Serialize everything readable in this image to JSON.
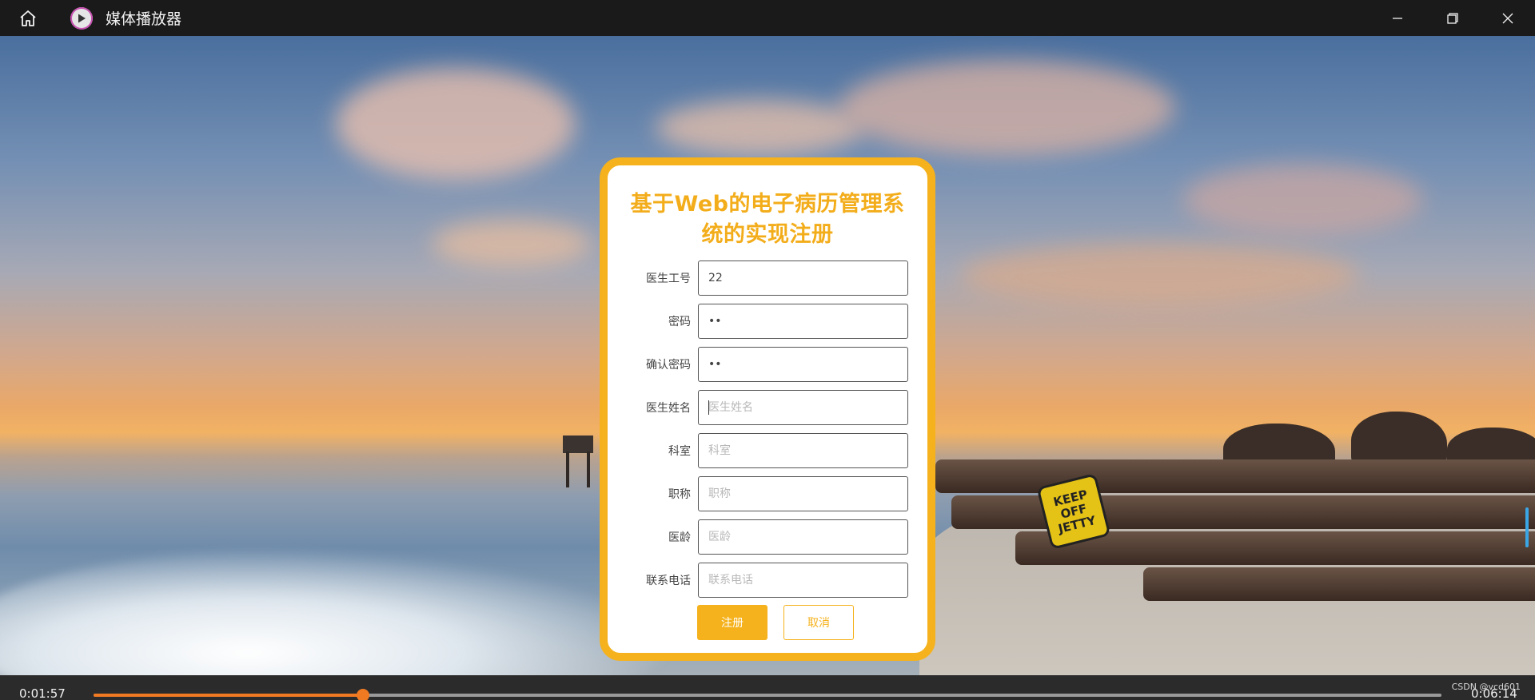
{
  "window": {
    "title": "媒体播放器",
    "icons": {
      "home": "home-icon",
      "app": "play-circle-icon",
      "minimize": "minimize-icon",
      "maximize": "restore-icon",
      "close": "close-icon"
    }
  },
  "form": {
    "title": "基于Web的电子病历管理系统的实现注册",
    "fields": [
      {
        "label": "医生工号",
        "value": "22",
        "placeholder": ""
      },
      {
        "label": "密码",
        "value": "••",
        "placeholder": ""
      },
      {
        "label": "确认密码",
        "value": "••",
        "placeholder": ""
      },
      {
        "label": "医生姓名",
        "value": "",
        "placeholder": "医生姓名"
      },
      {
        "label": "科室",
        "value": "",
        "placeholder": "科室"
      },
      {
        "label": "职称",
        "value": "",
        "placeholder": "职称"
      },
      {
        "label": "医龄",
        "value": "",
        "placeholder": "医龄"
      },
      {
        "label": "联系电话",
        "value": "",
        "placeholder": "联系电话"
      }
    ],
    "buttons": {
      "submit": "注册",
      "cancel": "取消"
    }
  },
  "scene": {
    "sign_lines": [
      "KEEP",
      "OFF",
      "JETTY"
    ]
  },
  "playback": {
    "current_time": "0:01:57",
    "total_time": "0:06:14",
    "progress": 0.2
  },
  "watermark": "CSDN @vcd601",
  "colors": {
    "accent": "#f5b21c",
    "progress": "#f07a22"
  }
}
